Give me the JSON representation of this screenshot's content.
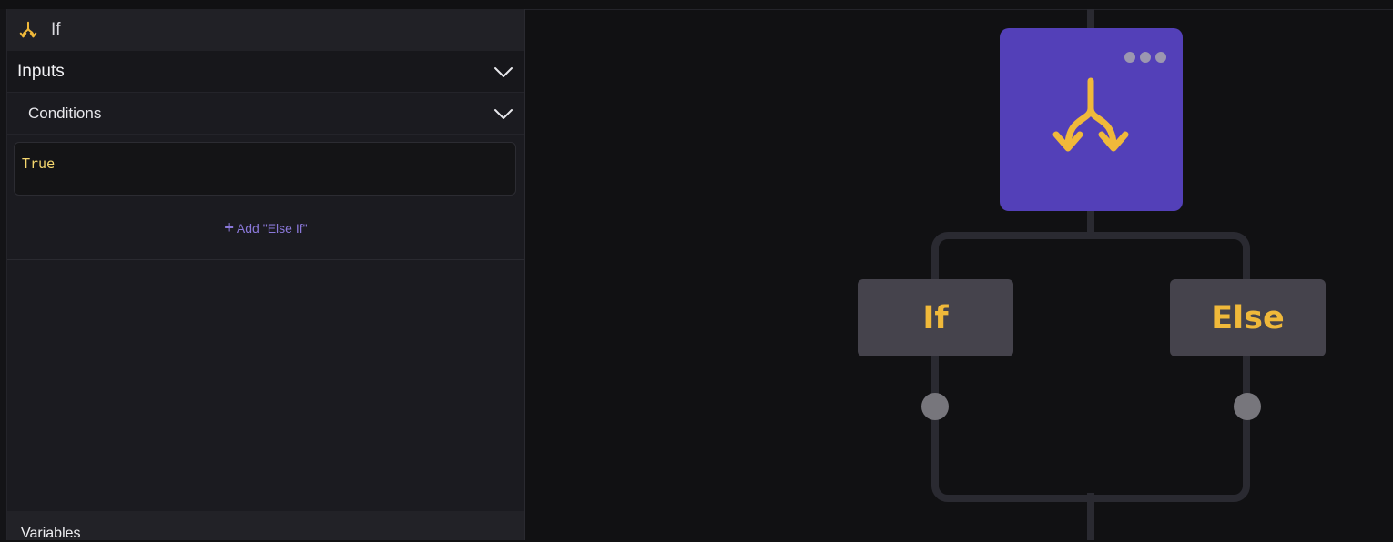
{
  "panel": {
    "title": "If",
    "inputs_label": "Inputs",
    "conditions_label": "Conditions",
    "condition_value": "True",
    "add_else_if": "Add \"Else If\"",
    "variables_label": "Variables"
  },
  "canvas": {
    "branches": [
      "If",
      "Else"
    ]
  },
  "colors": {
    "accent_yellow": "#f0b93a",
    "node_purple": "#5340b8",
    "link_purple": "#8a78d9"
  },
  "icons": [
    "split-icon",
    "chevron-down-icon",
    "more-options-icon",
    "plus-icon"
  ]
}
